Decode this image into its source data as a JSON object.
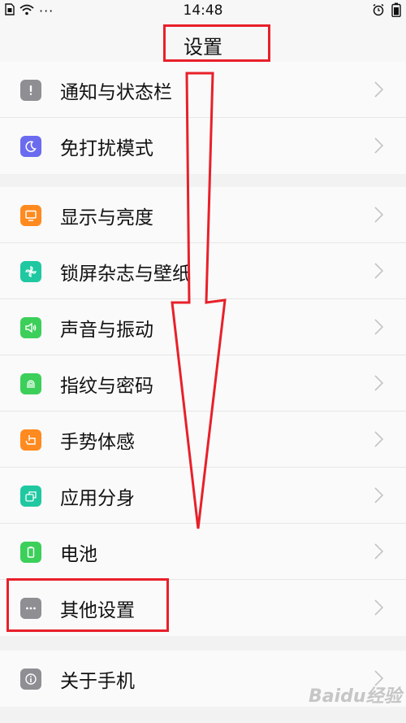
{
  "status_bar": {
    "time": "14:48",
    "dots": "···"
  },
  "header": {
    "title": "设置"
  },
  "groups": [
    {
      "items": [
        {
          "label": "通知与状态栏",
          "icon": "exclamation-icon",
          "color": "#8e8e93"
        },
        {
          "label": "免打扰模式",
          "icon": "moon-icon",
          "color": "#6b6bf0"
        }
      ]
    },
    {
      "items": [
        {
          "label": "显示与亮度",
          "icon": "monitor-icon",
          "color": "#ff8a1f"
        },
        {
          "label": "锁屏杂志与壁纸",
          "icon": "pinwheel-icon",
          "color": "#1fc8a0"
        },
        {
          "label": "声音与振动",
          "icon": "speaker-icon",
          "color": "#3ccf5a"
        },
        {
          "label": "指纹与密码",
          "icon": "fingerprint-icon",
          "color": "#3ccf5a"
        },
        {
          "label": "手势体感",
          "icon": "hand-icon",
          "color": "#ff8a1f"
        },
        {
          "label": "应用分身",
          "icon": "clone-icon",
          "color": "#1fc8a0"
        },
        {
          "label": "电池",
          "icon": "battery-icon",
          "color": "#3ccf5a"
        },
        {
          "label": "其他设置",
          "icon": "more-dots-icon",
          "color": "#8e8e93"
        }
      ]
    },
    {
      "items": [
        {
          "label": "关于手机",
          "icon": "info-icon",
          "color": "#8e8e93"
        }
      ]
    }
  ],
  "annotation_color": "#e8202a",
  "watermark": "Baidu经验"
}
